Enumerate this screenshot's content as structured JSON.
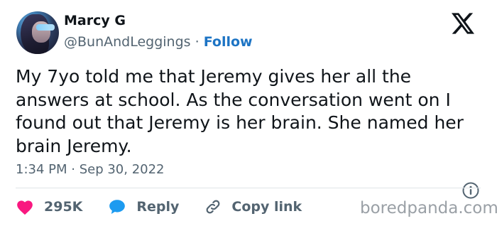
{
  "author": {
    "name": "Marcy G",
    "handle": "@BunAndLeggings",
    "separator": "·",
    "follow_label": "Follow"
  },
  "tweet": {
    "text": "My 7yo told me that Jeremy gives her all the answers at school. As the conversation went on I found out that Jeremy is her brain. She named her brain Jeremy.",
    "timestamp": "1:34 PM · Sep 30, 2022"
  },
  "actions": {
    "likes_count": "295K",
    "reply_label": "Reply",
    "copy_link_label": "Copy link"
  },
  "watermark": "boredpanda.com",
  "icons": {
    "logo": "x-logo-icon",
    "like": "heart-icon",
    "reply": "speech-bubble-icon",
    "copy": "link-icon",
    "info": "info-icon"
  },
  "colors": {
    "like": "#f91880",
    "reply": "#1d9bf0",
    "follow": "#1d74c4",
    "muted": "#536471"
  }
}
